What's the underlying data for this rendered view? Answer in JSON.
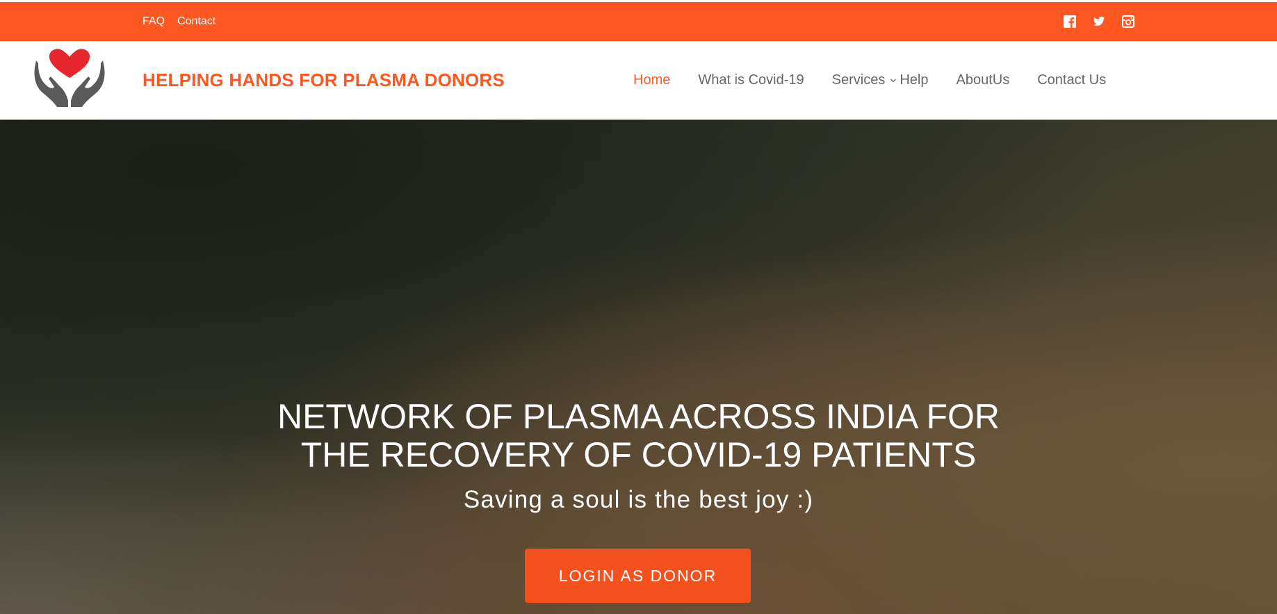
{
  "topbar": {
    "links": [
      "FAQ",
      "Contact"
    ],
    "social_icons": [
      "facebook-icon",
      "twitter-icon",
      "instagram-icon"
    ],
    "color": "#ff5722"
  },
  "header": {
    "logo_icon": "hands-holding-heart-icon",
    "brand": "HELPING HANDS FOR PLASMA DONORS",
    "nav": [
      {
        "label": "Home",
        "active": true
      },
      {
        "label": "What is Covid-19",
        "active": false
      },
      {
        "label": "Services",
        "active": false,
        "dropdown": true
      },
      {
        "label": "Help",
        "active": false
      },
      {
        "label": "AboutUs",
        "active": false
      },
      {
        "label": "Contact Us",
        "active": false
      }
    ],
    "accent_color": "#ff5722",
    "nav_color": "#666666"
  },
  "hero": {
    "title_line1": "NETWORK OF PLASMA ACROSS INDIA FOR",
    "title_line2": "THE RECOVERY OF COVID-19 PATIENTS",
    "subtitle": "Saving a soul is the best joy :)",
    "cta": "LOGIN AS DONOR",
    "cta_color": "#f4511e"
  }
}
